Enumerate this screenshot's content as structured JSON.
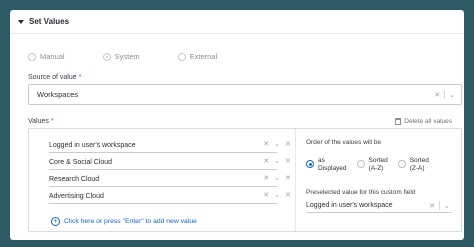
{
  "header": {
    "title": "Set Values"
  },
  "radios": [
    {
      "label": "Manual"
    },
    {
      "label": "System"
    },
    {
      "label": "External"
    }
  ],
  "source": {
    "label": "Source of value",
    "required_mark": "*",
    "value": "Workspaces"
  },
  "values": {
    "label": "Values",
    "required_mark": "*",
    "delete_all": "Delete all values",
    "items": [
      "Logged in user's workspace",
      "Core & Social Cloud",
      "Research Cloud",
      "Advertising Cloud"
    ],
    "add_link": "Click here or press \"Enter\" to add new value"
  },
  "order": {
    "label": "Order of the values will be",
    "options": [
      {
        "line1": "as",
        "line2": "Displayed",
        "selected": true
      },
      {
        "line1": "Sorted",
        "line2": "(A-Z)",
        "selected": false
      },
      {
        "line1": "Sorted",
        "line2": "(Z-A)",
        "selected": false
      }
    ]
  },
  "preselect": {
    "label": "Preselected value for this custom field",
    "value": "Logged in user's workspace"
  },
  "colors": {
    "accent": "#1b64c9",
    "background": "#2e5a66",
    "required": "#d6334a"
  }
}
